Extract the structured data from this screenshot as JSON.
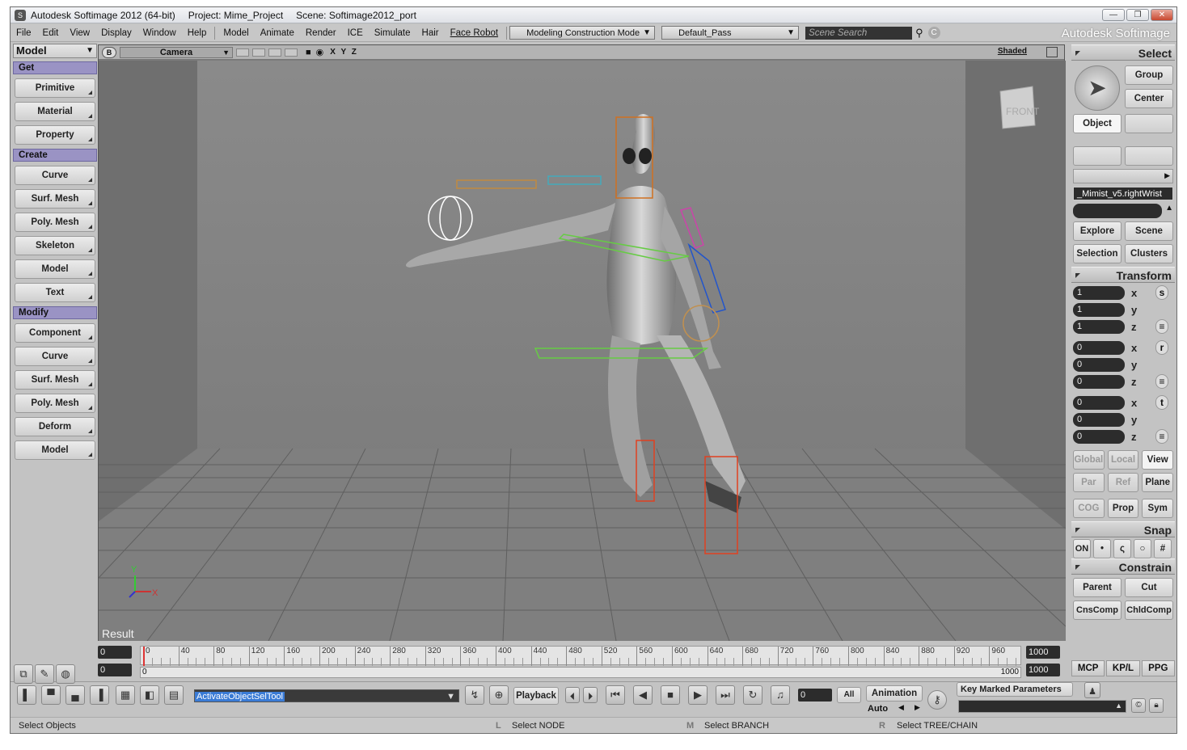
{
  "titlebar": {
    "app": "Autodesk Softimage 2012 (64-bit)",
    "project": "Project: Mime_Project",
    "scene": "Scene: Softimage2012_port",
    "min": "—",
    "max": "❐",
    "close": "✕"
  },
  "menu": [
    "File",
    "Edit",
    "View",
    "Display",
    "Window",
    "Help",
    "Model",
    "Animate",
    "Render",
    "ICE",
    "Simulate",
    "Hair",
    "Face Robot"
  ],
  "mode_dropdown": "Modeling Construction Mode",
  "pass_dropdown": "Default_Pass",
  "search": {
    "placeholder": "Scene Search"
  },
  "brand": "Autodesk Softimage",
  "left": {
    "module": "Model",
    "sections": [
      {
        "title": "Get",
        "items": [
          "Primitive",
          "Material",
          "Property"
        ]
      },
      {
        "title": "Create",
        "items": [
          "Curve",
          "Surf. Mesh",
          "Poly. Mesh",
          "Skeleton",
          "Model",
          "Text"
        ]
      },
      {
        "title": "Modify",
        "items": [
          "Component",
          "Curve",
          "Surf. Mesh",
          "Poly. Mesh",
          "Deform",
          "Model"
        ]
      }
    ]
  },
  "viewport": {
    "badge": "B",
    "camera": "Camera",
    "axes": "X Y Z",
    "shading": "Shaded",
    "cube_label": "FRONT",
    "result_label": "Result",
    "axis_y": "Y",
    "axis_x": "X"
  },
  "right": {
    "select_title": "Select",
    "group": "Group",
    "center": "Center",
    "object": "Object",
    "selected_object": "_Mimist_v5.rightWrist",
    "explore": "Explore",
    "scene": "Scene",
    "selection": "Selection",
    "clusters": "Clusters",
    "transform_title": "Transform",
    "scale": [
      "1",
      "1",
      "1"
    ],
    "rotate": [
      "0",
      "0",
      "0"
    ],
    "translate": [
      "0",
      "0",
      "0"
    ],
    "axes": [
      "x",
      "y",
      "z"
    ],
    "side_s": "s",
    "side_r": "r",
    "side_t": "t",
    "global": "Global",
    "local": "Local",
    "view": "View",
    "par": "Par",
    "ref": "Ref",
    "plane": "Plane",
    "cog": "COG",
    "prop": "Prop",
    "sym": "Sym",
    "snap_title": "Snap",
    "snap_on": "ON",
    "constrain_title": "Constrain",
    "parent": "Parent",
    "cut": "Cut",
    "cnscomp": "CnsComp",
    "chldcomp": "ChldComp",
    "mcp": "MCP",
    "kpl": "KP/L",
    "ppg": "PPG"
  },
  "timeline": {
    "start": "0",
    "end": "1000",
    "start2": "0",
    "zero": "0",
    "end2": "1000",
    "end2b": "1000",
    "ticks": [
      "0",
      "40",
      "80",
      "120",
      "160",
      "200",
      "240",
      "280",
      "320",
      "360",
      "400",
      "440",
      "480",
      "520",
      "560",
      "600",
      "640",
      "680",
      "720",
      "760",
      "800",
      "840",
      "880",
      "920",
      "960"
    ]
  },
  "bottom": {
    "command": "ActivateObjectSelTool",
    "playback": "Playback",
    "frame": "0",
    "all": "All",
    "animation": "Animation",
    "auto": "Auto",
    "key_marked": "Key Marked Parameters"
  },
  "status": {
    "left": "Select Objects",
    "l": "L",
    "node": "Select NODE",
    "m": "M",
    "branch": "Select BRANCH",
    "r": "R",
    "tree": "Select TREE/CHAIN"
  }
}
